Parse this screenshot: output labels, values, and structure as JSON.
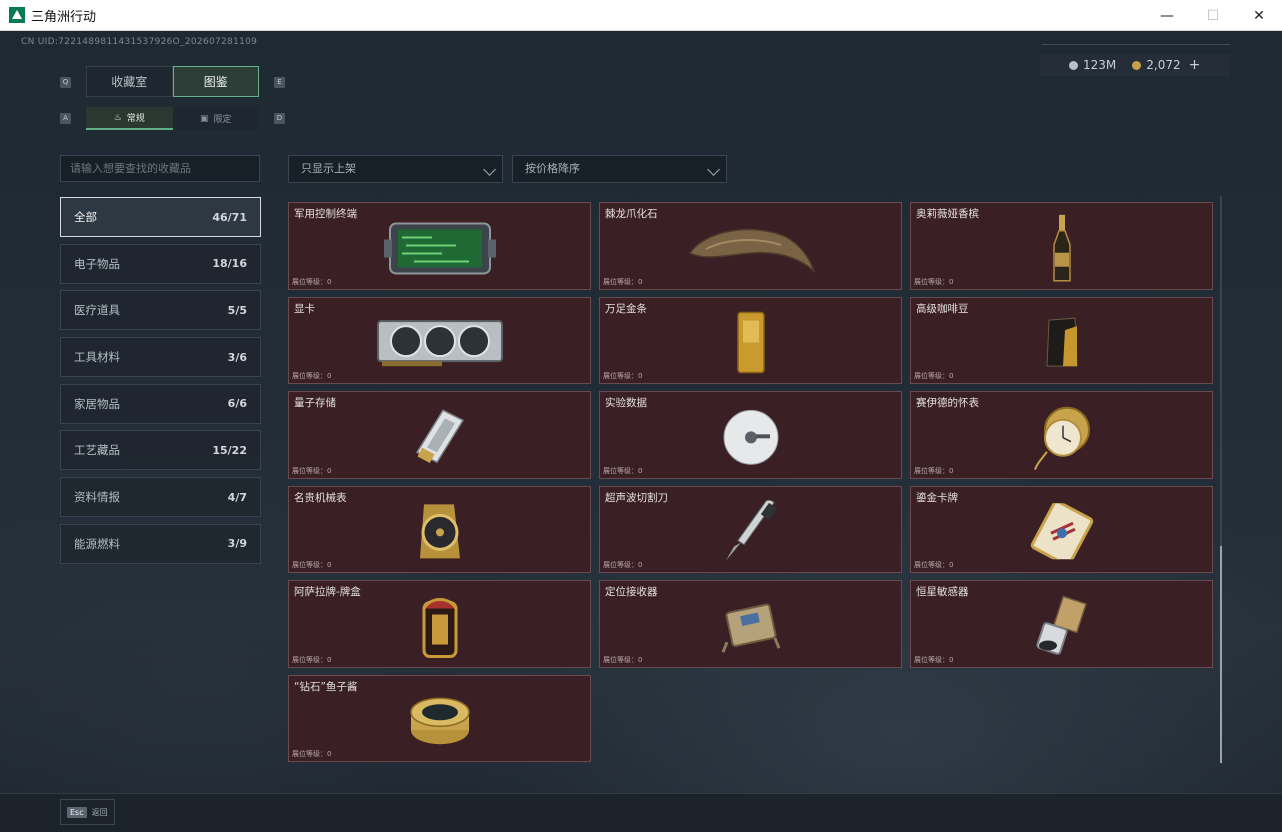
{
  "window": {
    "title": "三角洲行动",
    "minimize": "—",
    "maximize": "☐",
    "close": "✕"
  },
  "uid": "CN UID:7221489811431537926O_202607281109",
  "currency": {
    "silver": "123M",
    "gold": "2,072",
    "add": "+",
    "silver_color": "#b9bfc4",
    "gold_color": "#c7a24a"
  },
  "keys": {
    "tab_prev": "Q",
    "tab_next": "E",
    "sub_prev": "A",
    "sub_next": "D"
  },
  "tabs": [
    {
      "label": "收藏室",
      "active": false
    },
    {
      "label": "图鉴",
      "active": true
    }
  ],
  "subtabs": [
    {
      "label": "常规",
      "icon": "flame-icon",
      "active": true
    },
    {
      "label": "限定",
      "icon": "limited-icon",
      "active": false
    }
  ],
  "search": {
    "placeholder": "请输入想要查找的收藏品"
  },
  "filters": {
    "listing": "只显示上架",
    "sort": "按价格降序"
  },
  "categories": [
    {
      "label": "全部",
      "count": "46/71",
      "active": true
    },
    {
      "label": "电子物品",
      "count": "18/16",
      "active": false
    },
    {
      "label": "医疗道具",
      "count": "5/5",
      "active": false
    },
    {
      "label": "工具材料",
      "count": "3/6",
      "active": false
    },
    {
      "label": "家居物品",
      "count": "6/6",
      "active": false
    },
    {
      "label": "工艺藏品",
      "count": "15/22",
      "active": false
    },
    {
      "label": "资料情报",
      "count": "4/7",
      "active": false
    },
    {
      "label": "能源燃料",
      "count": "3/9",
      "active": false
    }
  ],
  "items": [
    {
      "name": "军用控制终端",
      "level": "展位等级：0",
      "icon": "military-terminal-icon"
    },
    {
      "name": "棘龙爪化石",
      "level": "展位等级：0",
      "icon": "claw-fossil-icon"
    },
    {
      "name": "奥莉薇娅香槟",
      "level": "展位等级：0",
      "icon": "champagne-bottle-icon"
    },
    {
      "name": "显卡",
      "level": "展位等级：0",
      "icon": "graphics-card-icon"
    },
    {
      "name": "万足金条",
      "level": "展位等级：0",
      "icon": "gold-bar-icon"
    },
    {
      "name": "高级咖啡豆",
      "level": "展位等级：0",
      "icon": "coffee-bag-icon"
    },
    {
      "name": "量子存储",
      "level": "展位等级：0",
      "icon": "quantum-storage-icon"
    },
    {
      "name": "实验数据",
      "level": "展位等级：0",
      "icon": "disc-icon"
    },
    {
      "name": "赛伊德的怀表",
      "level": "展位等级：0",
      "icon": "pocket-watch-icon"
    },
    {
      "name": "名贵机械表",
      "level": "展位等级：0",
      "icon": "wristwatch-icon"
    },
    {
      "name": "超声波切割刀",
      "level": "展位等级：0",
      "icon": "ultrasonic-knife-icon"
    },
    {
      "name": "鎏金卡牌",
      "level": "展位等级：0",
      "icon": "gilded-card-icon"
    },
    {
      "name": "阿萨拉牌-牌盒",
      "level": "展位等级：0",
      "icon": "card-box-icon"
    },
    {
      "name": "定位接收器",
      "level": "展位等级：0",
      "icon": "locator-receiver-icon"
    },
    {
      "name": "恒星敏感器",
      "level": "展位等级：0",
      "icon": "star-sensor-icon"
    },
    {
      "name": "“钻石”鱼子酱",
      "level": "展位等级：0",
      "icon": "caviar-tin-icon"
    }
  ],
  "footer": {
    "esc_key": "Esc",
    "back": "返回"
  }
}
